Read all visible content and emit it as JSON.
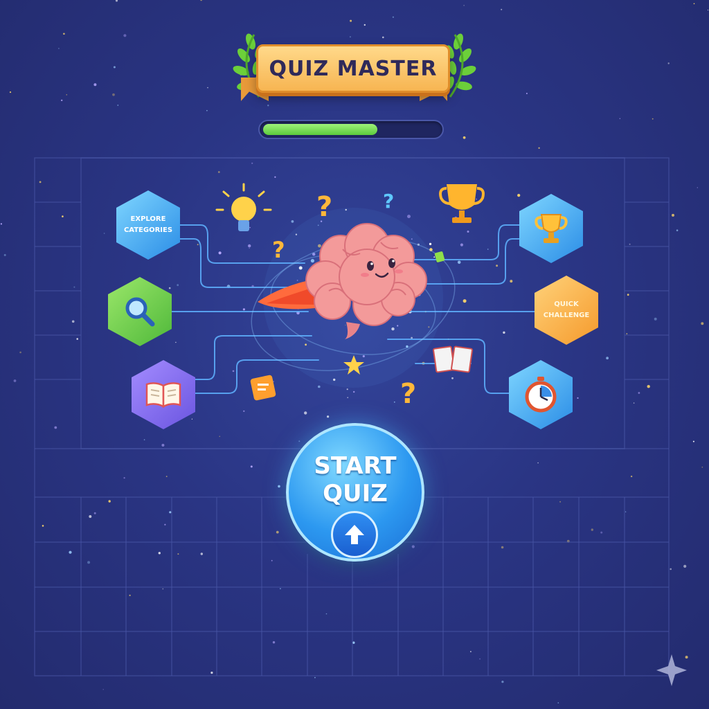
{
  "title": {
    "text": "QUIZ MASTER"
  },
  "progress": {
    "fraction": 0.65
  },
  "nodes": {
    "explore": {
      "label": "Explore Categories",
      "icon": "explore-categories"
    },
    "search": {
      "icon": "magnifying-glass-icon"
    },
    "study": {
      "icon": "open-book-icon"
    },
    "leaderboard": {
      "icon": "trophy-icon"
    },
    "quick": {
      "label": "Quick Challenge",
      "icon": "quick-challenge"
    },
    "timed": {
      "icon": "stopwatch-icon"
    }
  },
  "start_button": {
    "label": "START QUIZ",
    "icon": "up-arrow-icon"
  },
  "mascot": {
    "icon": "brain-mascot-icon"
  },
  "colors": {
    "background": "#2a3584",
    "banner": "#f7b552",
    "progress": "#5ccb3c",
    "start": "#2c98f0"
  }
}
